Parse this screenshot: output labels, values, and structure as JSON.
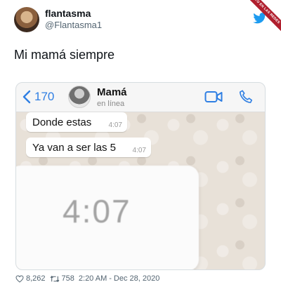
{
  "author": {
    "display_name": "flantasma",
    "handle": "@Flantasma1"
  },
  "watermark": "VISTO EN LAS REDES",
  "tweet_text": "Mi mamá siempre",
  "whatsapp": {
    "back_count": "170",
    "contact_name": "Mamá",
    "contact_status": "en línea",
    "messages": [
      {
        "text": "Donde estas",
        "time": "4:07"
      },
      {
        "text": "Ya van a ser las 5",
        "time": "4:07"
      }
    ],
    "zoomed_time": "4:07"
  },
  "footer": {
    "likes": "8,262",
    "retweets": "758",
    "time": "2:20 AM",
    "separator": "-",
    "date": "Dec 28, 2020"
  },
  "colors": {
    "twitter_blue": "#1d9bf0",
    "ios_blue": "#2f7fe3",
    "watermark_red": "#b01f2e"
  },
  "icons": [
    "twitter-bird-icon",
    "back-chevron-icon",
    "video-call-icon",
    "phone-call-icon",
    "like-heart-icon",
    "retweet-icon"
  ]
}
